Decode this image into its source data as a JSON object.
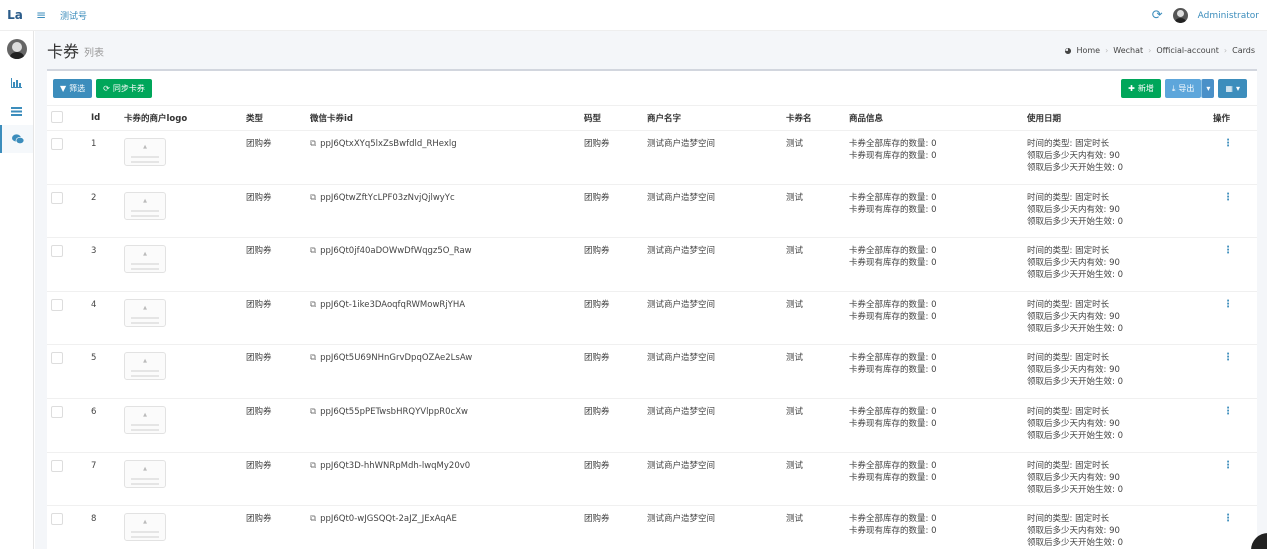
{
  "navbar": {
    "logo": "La",
    "menu_icon": "bars-icon",
    "site_name": "测试号",
    "refresh_icon": "refresh-icon",
    "user_name": "Administrator"
  },
  "sidebar": {
    "items": [
      {
        "icon": "bar-chart-icon"
      },
      {
        "icon": "list-icon"
      },
      {
        "icon": "wechat-icon",
        "active": true
      }
    ]
  },
  "header": {
    "title": "卡券",
    "subtitle": "列表",
    "breadcrumb": [
      "Home",
      "Wechat",
      "Official-account",
      "Cards"
    ]
  },
  "toolbar": {
    "filter_label": "筛选",
    "sync_label": "同步卡券",
    "new_label": "新增",
    "export_label": "导出"
  },
  "table": {
    "columns": [
      "Id",
      "卡券的商户logo",
      "类型",
      "微信卡券id",
      "码型",
      "商户名字",
      "卡券名",
      "商品信息",
      "使用日期",
      "操作"
    ],
    "rows": [
      {
        "id": "1",
        "type": "团购券",
        "card_id": "ppJ6QtxXYq5lxZsBwfdld_RHexlg",
        "code_type": "团购券",
        "merchant": "测试商户造梦空间",
        "name": "测试",
        "stock_total": "卡券全部库存的数量: 0",
        "stock_now": "卡券现有库存的数量: 0",
        "date_type": "时间的类型: 固定时长",
        "valid_days": "领取后多少天内有效: 90",
        "start_days": "领取后多少天开始生效: 0"
      },
      {
        "id": "2",
        "type": "团购券",
        "card_id": "ppJ6QtwZftYcLPF03zNvjQjlwyYc",
        "code_type": "团购券",
        "merchant": "测试商户造梦空间",
        "name": "测试",
        "stock_total": "卡券全部库存的数量: 0",
        "stock_now": "卡券现有库存的数量: 0",
        "date_type": "时间的类型: 固定时长",
        "valid_days": "领取后多少天内有效: 90",
        "start_days": "领取后多少天开始生效: 0"
      },
      {
        "id": "3",
        "type": "团购券",
        "card_id": "ppJ6Qt0jf40aDOWwDfWqgz5O_Raw",
        "code_type": "团购券",
        "merchant": "测试商户造梦空间",
        "name": "测试",
        "stock_total": "卡券全部库存的数量: 0",
        "stock_now": "卡券现有库存的数量: 0",
        "date_type": "时间的类型: 固定时长",
        "valid_days": "领取后多少天内有效: 90",
        "start_days": "领取后多少天开始生效: 0"
      },
      {
        "id": "4",
        "type": "团购券",
        "card_id": "ppJ6Qt-1ike3DAoqfqRWMowRjYHA",
        "code_type": "团购券",
        "merchant": "测试商户造梦空间",
        "name": "测试",
        "stock_total": "卡券全部库存的数量: 0",
        "stock_now": "卡券现有库存的数量: 0",
        "date_type": "时间的类型: 固定时长",
        "valid_days": "领取后多少天内有效: 90",
        "start_days": "领取后多少天开始生效: 0"
      },
      {
        "id": "5",
        "type": "团购券",
        "card_id": "ppJ6Qt5U69NHnGrvDpqOZAe2LsAw",
        "code_type": "团购券",
        "merchant": "测试商户造梦空间",
        "name": "测试",
        "stock_total": "卡券全部库存的数量: 0",
        "stock_now": "卡券现有库存的数量: 0",
        "date_type": "时间的类型: 固定时长",
        "valid_days": "领取后多少天内有效: 90",
        "start_days": "领取后多少天开始生效: 0"
      },
      {
        "id": "6",
        "type": "团购券",
        "card_id": "ppJ6Qt55pPETwsbHRQYVlppR0cXw",
        "code_type": "团购券",
        "merchant": "测试商户造梦空间",
        "name": "测试",
        "stock_total": "卡券全部库存的数量: 0",
        "stock_now": "卡券现有库存的数量: 0",
        "date_type": "时间的类型: 固定时长",
        "valid_days": "领取后多少天内有效: 90",
        "start_days": "领取后多少天开始生效: 0"
      },
      {
        "id": "7",
        "type": "团购券",
        "card_id": "ppJ6Qt3D-hhWNRpMdh-lwqMy20v0",
        "code_type": "团购券",
        "merchant": "测试商户造梦空间",
        "name": "测试",
        "stock_total": "卡券全部库存的数量: 0",
        "stock_now": "卡券现有库存的数量: 0",
        "date_type": "时间的类型: 固定时长",
        "valid_days": "领取后多少天内有效: 90",
        "start_days": "领取后多少天开始生效: 0"
      },
      {
        "id": "8",
        "type": "团购券",
        "card_id": "ppJ6Qt0-wJGSQQt-2aJZ_JExAqAE",
        "code_type": "团购券",
        "merchant": "测试商户造梦空间",
        "name": "测试",
        "stock_total": "卡券全部库存的数量: 0",
        "stock_now": "卡券现有库存的数量: 0",
        "date_type": "时间的类型: 固定时长",
        "valid_days": "领取后多少天内有效: 90",
        "start_days": "领取后多少天开始生效: 0"
      }
    ]
  },
  "colors": {
    "accent": "#3c8dbc",
    "success": "#00a65a"
  }
}
